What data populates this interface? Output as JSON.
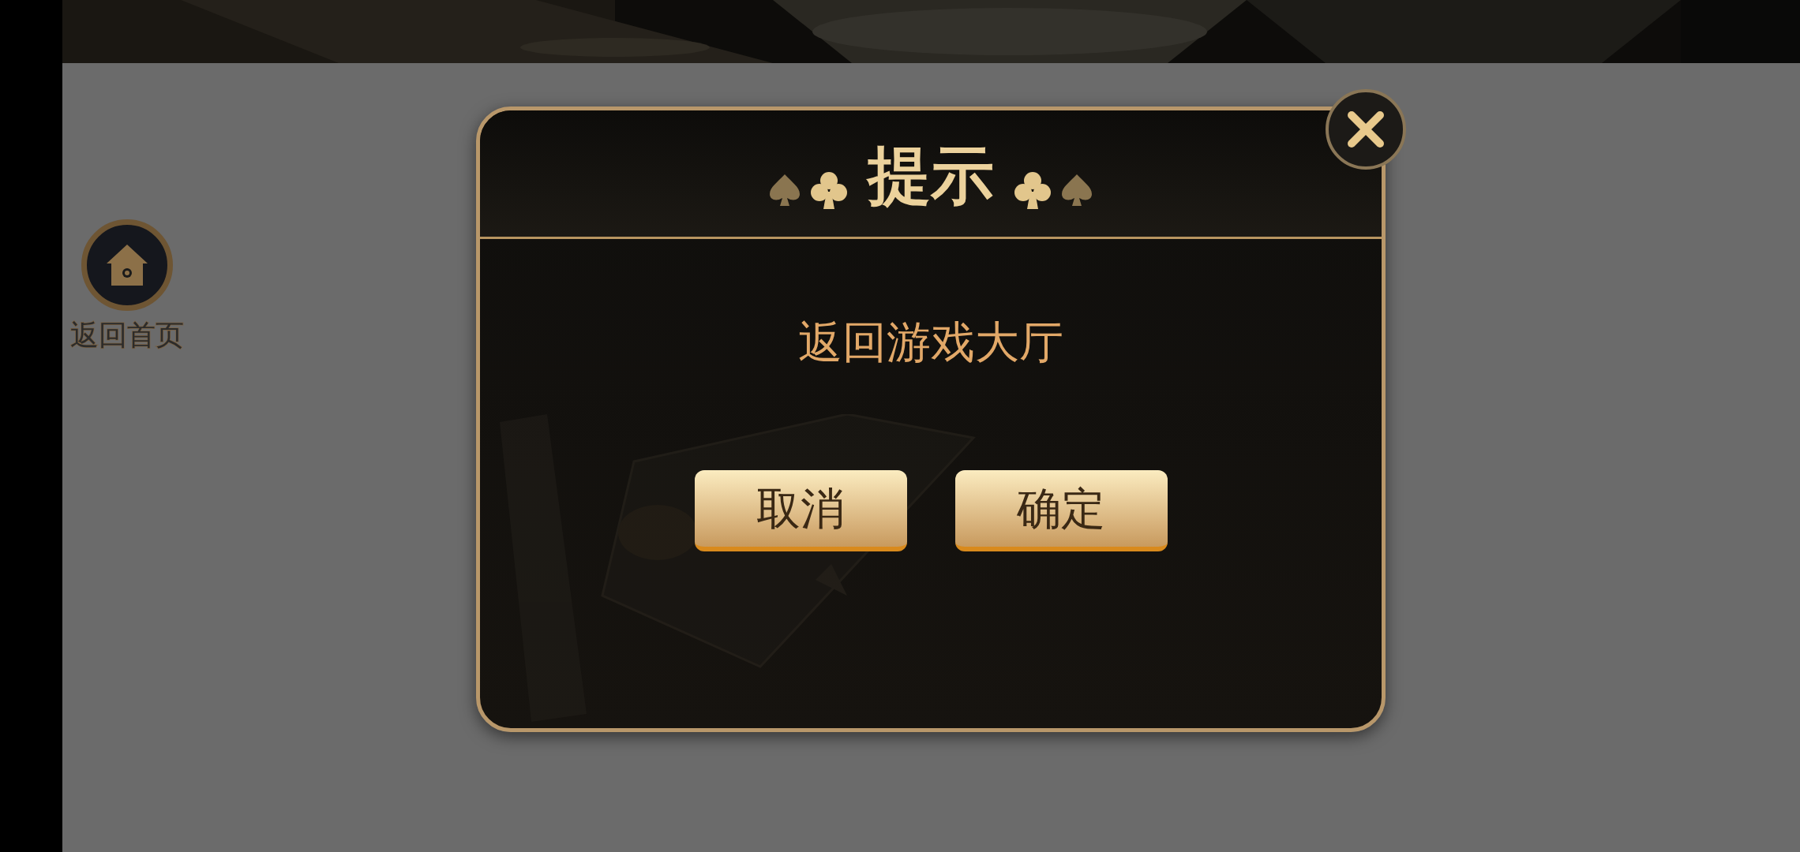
{
  "home_button": {
    "label": "返回首页"
  },
  "dialog": {
    "title": "提示",
    "message": "返回游戏大厅",
    "buttons": [
      "取消",
      "确定"
    ]
  }
}
